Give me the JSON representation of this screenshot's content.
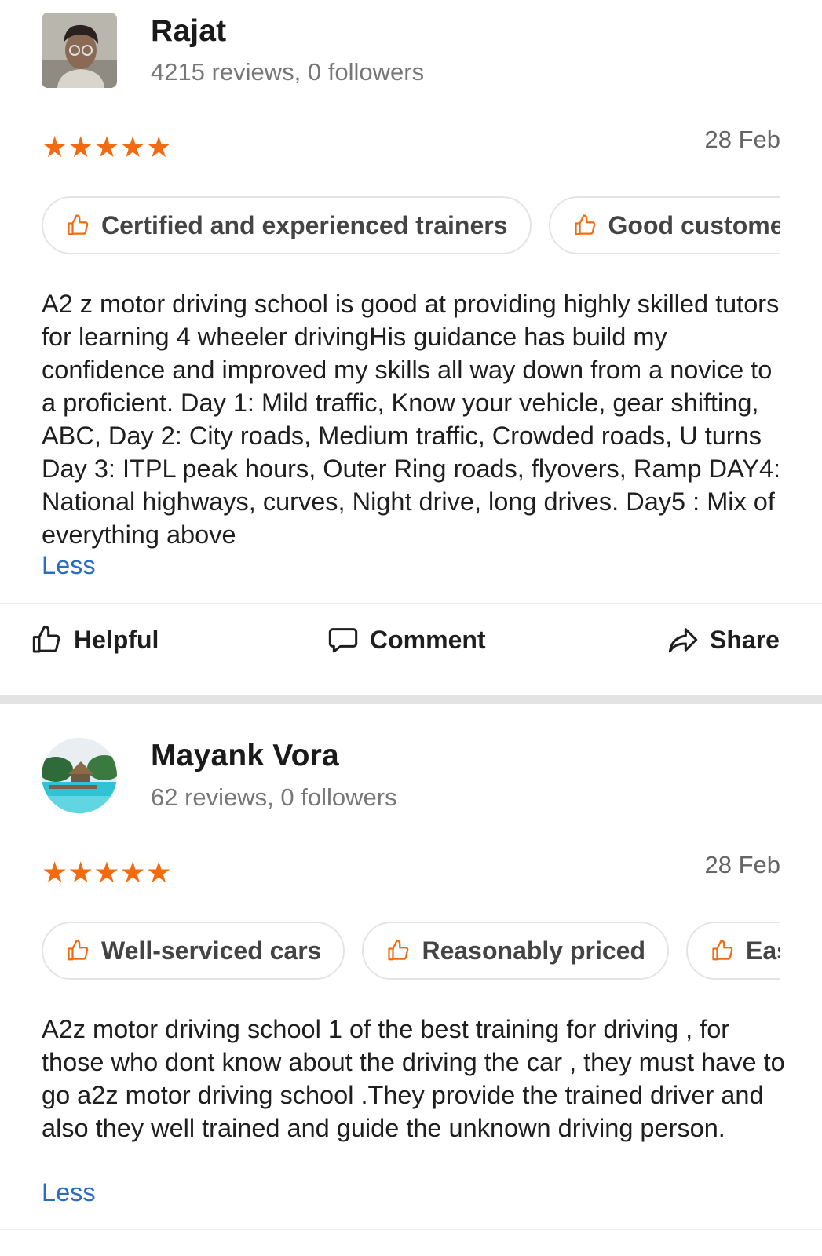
{
  "reviews": [
    {
      "name": "Rajat",
      "reviews_count": "4215 reviews,",
      "followers": "0 followers",
      "avatar_icon": "user-photo",
      "stars": "★★★★★",
      "rating": 5,
      "date": "28 Feb",
      "tags": [
        "Certified and experienced trainers",
        "Good custome"
      ],
      "text": "A2 z motor driving school is good at providing highly skilled tutors for learning 4 wheeler drivingHis guidance has build my confidence and improved my skills all way down from a novice to a proficient. Day 1: Mild traffic, Know your vehicle, gear shifting, ABC, Day 2: City roads, Medium traffic, Crowded roads, U turns Day 3: ITPL peak hours, Outer Ring roads, flyovers, Ramp DAY4: National highways, curves, Night drive, long drives. Day5 : Mix of everything above",
      "less": "Less"
    },
    {
      "name": "Mayank Vora",
      "reviews_count": "62 reviews,",
      "followers": "0 followers",
      "avatar_icon": "beach-photo",
      "stars": "★★★★★",
      "rating": 5,
      "date": "28 Feb",
      "tags": [
        "Well-serviced cars",
        "Reasonably priced",
        "Eas"
      ],
      "text": "A2z motor driving school 1 of the best training for driving , for those who dont know about the driving the car , they must have to go a2z motor driving school .They provide the trained driver and also they well trained and guide the unknown driving person.",
      "less": "Less"
    }
  ],
  "actions": {
    "helpful": "Helpful",
    "comment": "Comment",
    "share": "Share"
  },
  "colors": {
    "star": "#f36b10",
    "link": "#2a6cc2",
    "muted": "#777777"
  }
}
